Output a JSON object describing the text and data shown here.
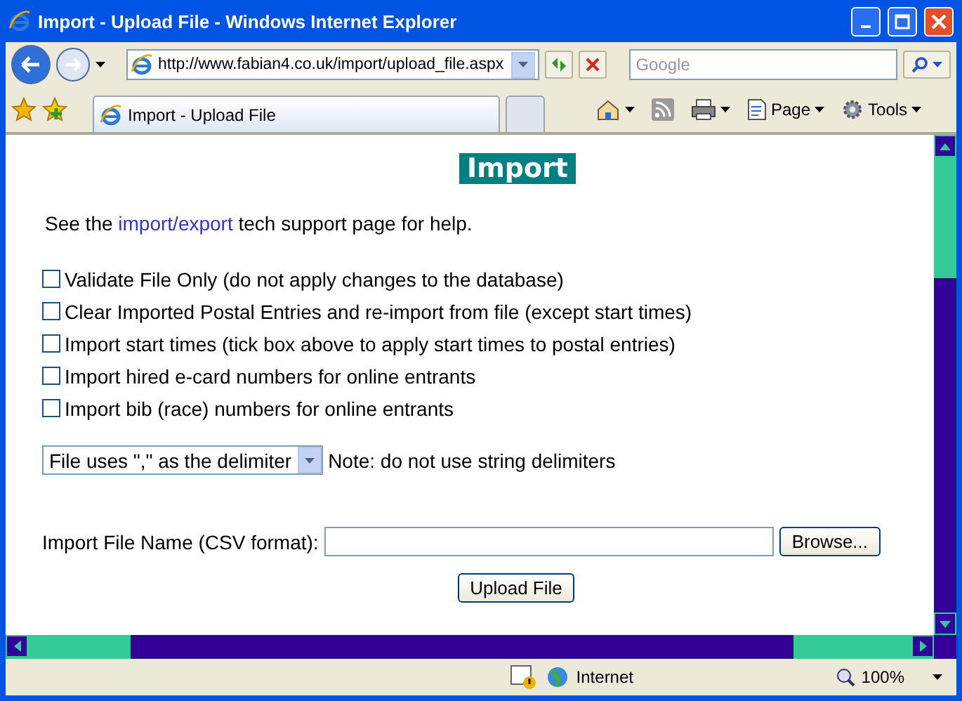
{
  "window": {
    "title": "Import - Upload File - Windows Internet Explorer"
  },
  "address_bar": {
    "value": "http://www.fabian4.co.uk/import/upload_file.aspx"
  },
  "search": {
    "placeholder": "Google"
  },
  "tabs": [
    {
      "label": "Import - Upload File",
      "selected": true
    }
  ],
  "command_bar": {
    "items": [
      "Page",
      "Tools"
    ]
  },
  "page": {
    "heading": "Import",
    "help": {
      "before": "See the ",
      "link": "import/export",
      "after": " tech support page for help."
    },
    "options": [
      {
        "label": "Validate File Only (do not apply changes to the database)",
        "checked": false
      },
      {
        "label": "Clear Imported Postal Entries and re-import from file (except start times)",
        "checked": false
      },
      {
        "label": "Import start times (tick box above to apply start times to postal entries)",
        "checked": false
      },
      {
        "label": "Import hired e-card numbers for online entrants",
        "checked": false
      },
      {
        "label": "Import bib (race) numbers for online entrants",
        "checked": false
      }
    ],
    "delimiter": {
      "value": "File uses \",\" as the delimiter",
      "note": "Note: do not use string delimiters"
    },
    "file": {
      "label": "Import File Name (CSV format):",
      "browse": "Browse...",
      "upload": "Upload File"
    }
  },
  "status_bar": {
    "zone": "Internet",
    "zoom": "100%"
  }
}
